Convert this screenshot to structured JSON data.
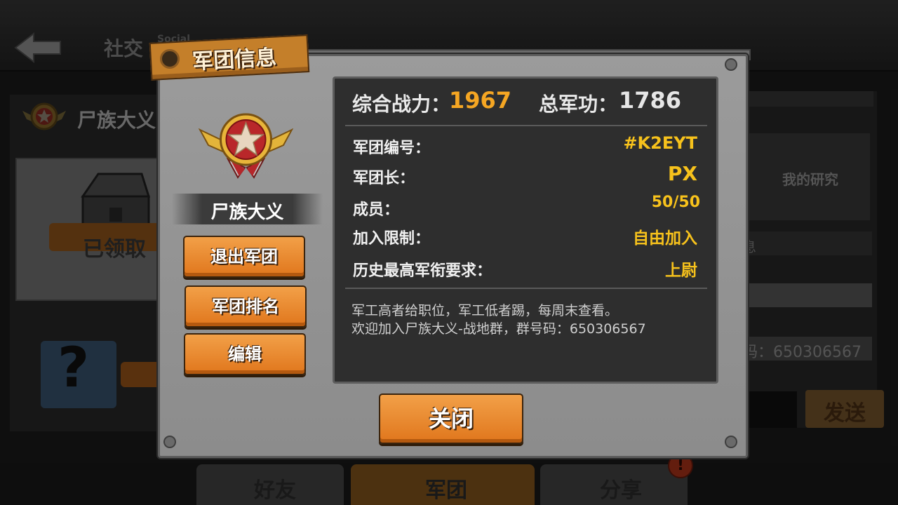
{
  "background": {
    "header_title": "社交",
    "header_subtitle": "Social",
    "legion_name": "尸族大义",
    "claimed_label": "已领取",
    "question_mark": "?",
    "research_label": "我的研究",
    "info_fragment": "息",
    "group_fragment": "码：650306567",
    "send_label": "发送",
    "tabs": [
      {
        "label": "好友"
      },
      {
        "label": "军团"
      },
      {
        "label": "分享"
      }
    ],
    "tab_alert": "!"
  },
  "dialog": {
    "title": "军团信息",
    "legion_name": "尸族大义",
    "buttons": {
      "quit": "退出军团",
      "rank": "军团排名",
      "edit": "编辑",
      "close": "关闭"
    },
    "stats": {
      "power_label": "综合战力：",
      "power_value": "1967",
      "merit_label": "总军功：",
      "merit_value": "1786"
    },
    "rows": [
      {
        "label": "军团编号：",
        "value": "#K2EYT"
      },
      {
        "label": "军团长：",
        "value": "PX"
      },
      {
        "label": "成员：",
        "value": "50/50"
      },
      {
        "label": "加入限制：",
        "value": "自由加入"
      },
      {
        "label": "历史最高军衔要求：",
        "value": "上尉"
      }
    ],
    "notice": [
      "军工高者给职位，军工低者踢，每周末查看。",
      "欢迎加入尸族大义-战地群，群号码：650306567"
    ]
  },
  "colors": {
    "accent_orange": "#e8862a",
    "value_yellow": "#f7c21c",
    "power_orange": "#f5a623",
    "merit_white": "#e6e6e6"
  }
}
